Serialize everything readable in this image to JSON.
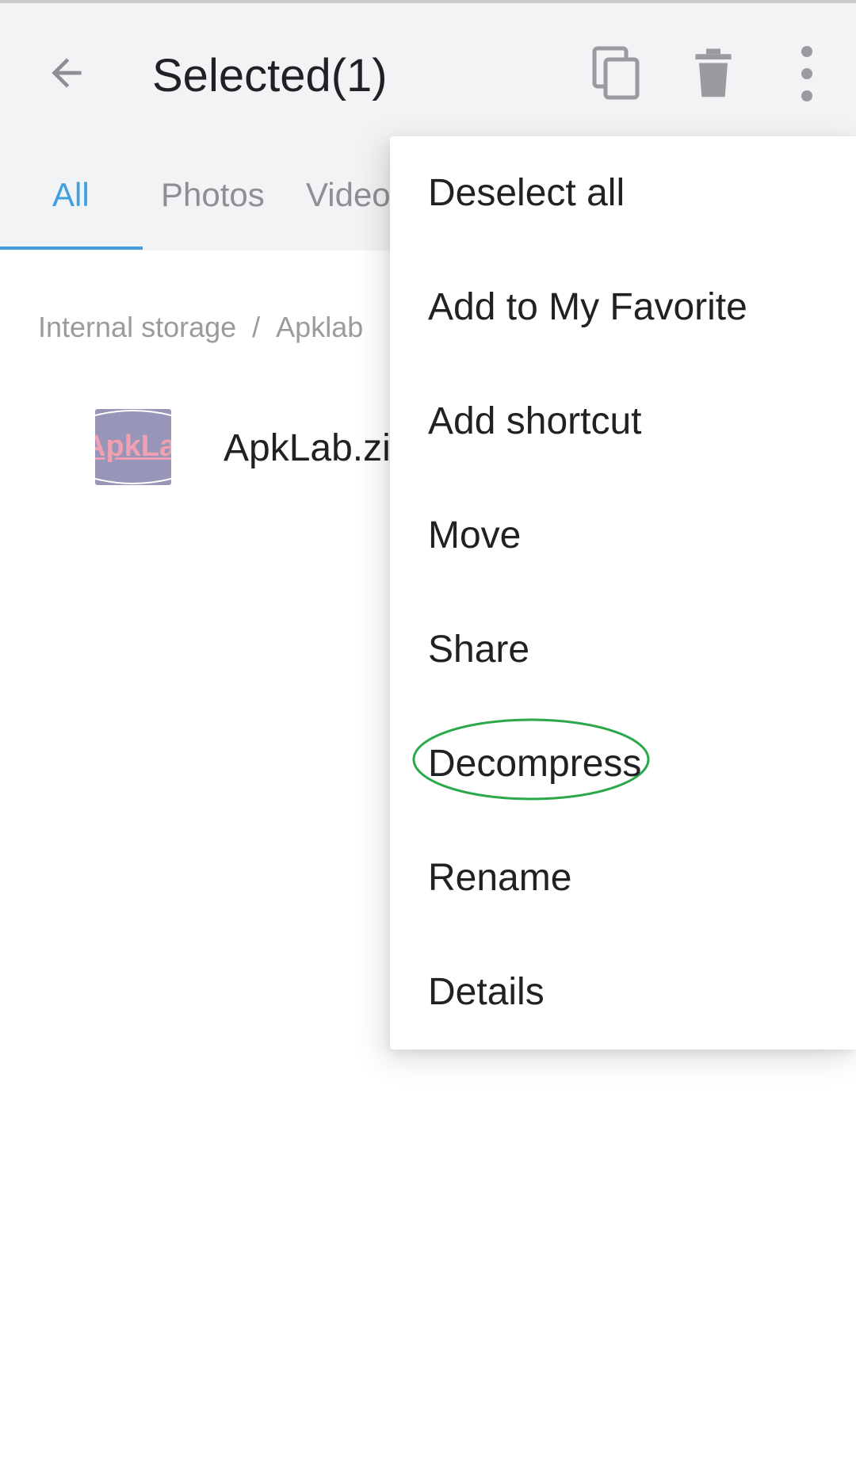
{
  "app_bar": {
    "title": "Selected(1)",
    "icons": {
      "back": "arrow-left-icon",
      "copy": "copy-icon",
      "delete": "trash-icon",
      "more": "more-vertical-icon"
    }
  },
  "tabs": [
    {
      "label": "All",
      "active": true
    },
    {
      "label": "Photos",
      "active": false
    },
    {
      "label": "Videos",
      "active": false
    }
  ],
  "breadcrumb": {
    "root": "Internal storage",
    "separator": "/",
    "folder": "Apklab"
  },
  "file": {
    "name": "ApkLab.zip",
    "thumbnail_text": "ApkLab"
  },
  "menu": {
    "items": [
      {
        "label": "Deselect all"
      },
      {
        "label": "Add to My Favorite"
      },
      {
        "label": "Add shortcut"
      },
      {
        "label": "Move"
      },
      {
        "label": "Share"
      },
      {
        "label": "Decompress",
        "highlighted": true
      },
      {
        "label": "Rename"
      },
      {
        "label": "Details"
      }
    ]
  },
  "colors": {
    "accent": "#3f9fe0",
    "highlight_ring": "#2aa84a",
    "app_bar_bg": "#f2f3f5"
  }
}
